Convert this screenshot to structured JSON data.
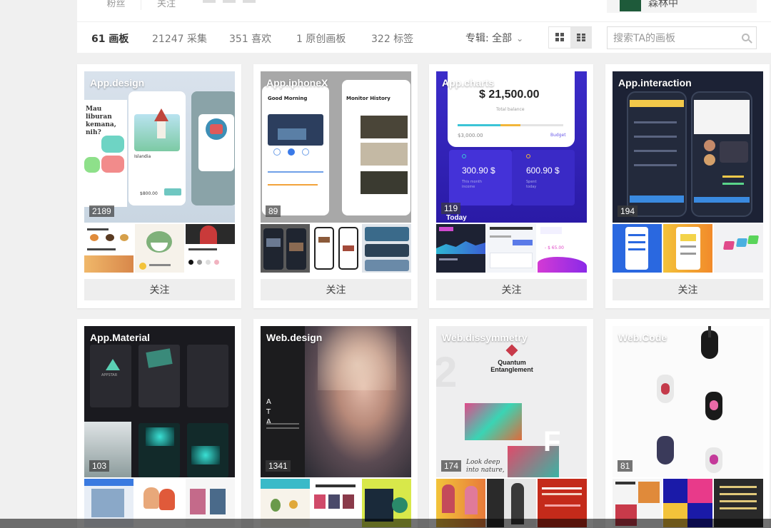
{
  "top": {
    "tab1": "粉丝",
    "tab2": "关注",
    "username": "森林中"
  },
  "stats": {
    "boards": "61 画板",
    "collects": "21247 采集",
    "likes": "351 喜欢",
    "original": "1 原创画板",
    "tags": "322 标签",
    "filter_label": "专辑: 全部",
    "filter_chevron": "chevron-down-icon",
    "view_modes": [
      "grid-large-icon",
      "grid-small-icon"
    ]
  },
  "search": {
    "placeholder": "搜索TA的画板",
    "value": ""
  },
  "follow_label": "关注",
  "boards": [
    {
      "title": "App.design",
      "count": "2189"
    },
    {
      "title": "App.iphoneX",
      "count": "89"
    },
    {
      "title": "App.charts",
      "count": "119"
    },
    {
      "title": "App.interaction",
      "count": "194"
    },
    {
      "title": "App.Material",
      "count": "103"
    },
    {
      "title": "Web.design",
      "count": "1341"
    },
    {
      "title": "Web.dissymmetry",
      "count": "174"
    },
    {
      "title": "Web.Code",
      "count": "81"
    }
  ],
  "cover_text": {
    "charts_amount": "$ 21,500.00",
    "charts_sub": "Total balance",
    "charts_left_value": "$3,000.00",
    "charts_right_label": "Budget",
    "charts_box1": "300.90 $",
    "charts_box1_sub": "This month income",
    "charts_box2": "600.90 $",
    "charts_box2_sub": "Spent today",
    "charts_today": "Today",
    "iphonex_left": "Good Morning",
    "iphonex_right": "Monitor History",
    "design_text": "Mau liburan kemana, nih?",
    "design_card": "Islandia",
    "design_price": "$800.00",
    "material_brand": "APPSTAR",
    "webdesign_letters": "A T A",
    "dissym_title": "Quantum Entanglement",
    "dissym_quote": "Look deep into nature,"
  }
}
